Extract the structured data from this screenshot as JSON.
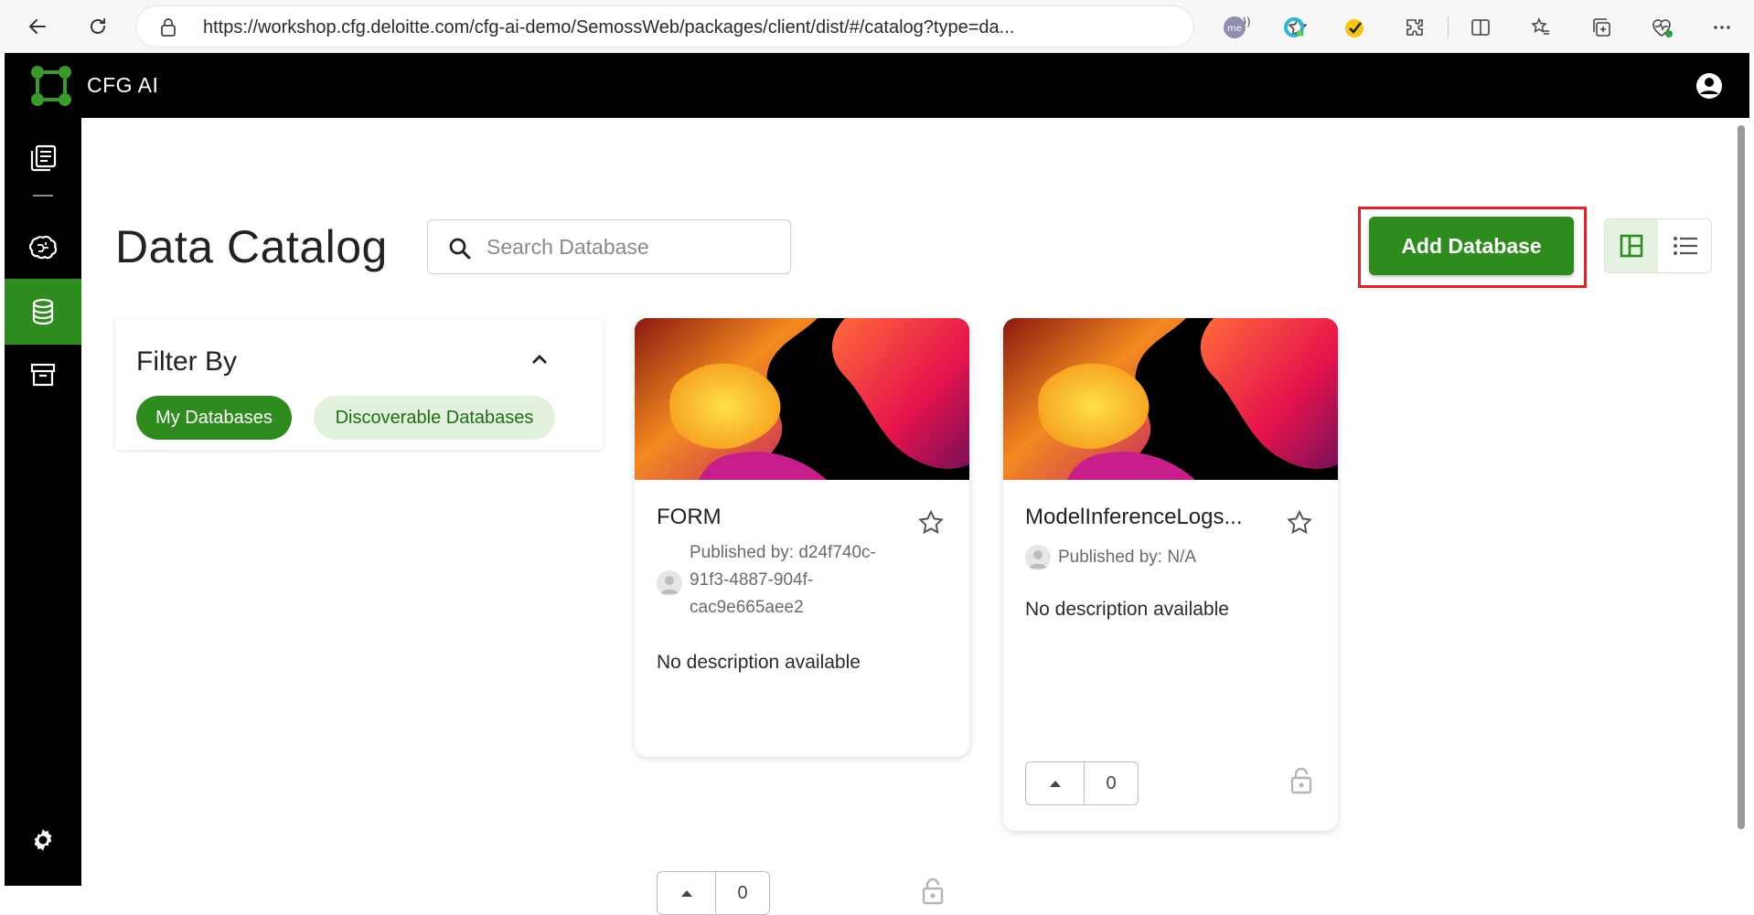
{
  "browser": {
    "url_host": "https://workshop.cfg.deloitte.com",
    "url_path": "/cfg-ai-demo/SemossWeb/packages/client/dist/#/catalog?type=da...",
    "read_aloud_glyph": "A))"
  },
  "app": {
    "title": "CFG AI"
  },
  "sidebar": {
    "items": [
      {
        "name": "catalog-icon",
        "active": false
      },
      {
        "name": "brain-icon",
        "active": false
      },
      {
        "name": "database-icon",
        "active": true
      },
      {
        "name": "archive-icon",
        "active": false
      },
      {
        "name": "settings-icon",
        "active": false
      }
    ]
  },
  "page": {
    "title": "Data Catalog",
    "search_placeholder": "Search Database",
    "search_value": "",
    "add_button_label": "Add Database"
  },
  "filter": {
    "title": "Filter By",
    "chips": [
      "My Databases",
      "Discoverable Databases"
    ]
  },
  "cards": [
    {
      "title": "FORM",
      "publisher_line1": "Published by: d24f740c-",
      "publisher_line2": "91f3-4887-904f-",
      "publisher_line3": "cac9e665aee2",
      "description": "No description available",
      "votes": "0"
    },
    {
      "title": "ModelInferenceLogs...",
      "publisher_line1": "Published by: N/A",
      "description": "No description available",
      "votes": "0"
    }
  ],
  "colors": {
    "brand_green": "#2e8b1e",
    "chip_light": "#e3f2df",
    "highlight_red": "#e0202a",
    "topbar": "#000000"
  }
}
